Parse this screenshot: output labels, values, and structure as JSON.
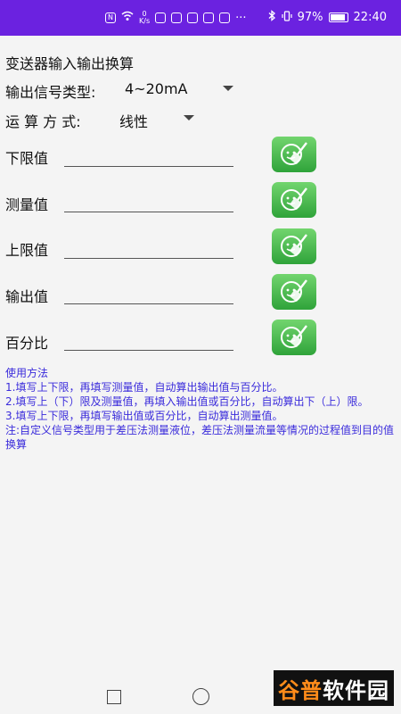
{
  "status_bar": {
    "speed_value": "0",
    "speed_unit": "K/s",
    "battery": "97%",
    "time": "22:40",
    "more": "···"
  },
  "app": {
    "title": "变送器输入输出换算",
    "signal_type": {
      "label": "输出信号类型:",
      "value": "4~20mA"
    },
    "calc_mode": {
      "label": "运 算 方 式:",
      "value": "线性"
    },
    "fields": [
      {
        "label": "下限值",
        "value": ""
      },
      {
        "label": "测量值",
        "value": ""
      },
      {
        "label": "上限值",
        "value": ""
      },
      {
        "label": "输出值",
        "value": ""
      },
      {
        "label": "百分比",
        "value": ""
      }
    ],
    "help": {
      "heading": "使用方法",
      "lines": [
        " 1.填写上下限，再填写测量值，自动算出输出值与百分比。",
        " 2.填写上（下）限及测量值，再填入输出值或百分比，自动算出下（上）限。",
        " 3.填写上下限，再填写输出值或百分比，自动算出测量值。",
        " 注:自定义信号类型用于差压法测量液位，差压法测量流量等情况的过程值到目的值换算"
      ]
    }
  },
  "watermark": {
    "text_a": "谷普",
    "text_b": "软件园"
  },
  "colors": {
    "status_bar": "#6b22e0",
    "help_text": "#3a2bdb",
    "clear_button": "#3fb545"
  }
}
